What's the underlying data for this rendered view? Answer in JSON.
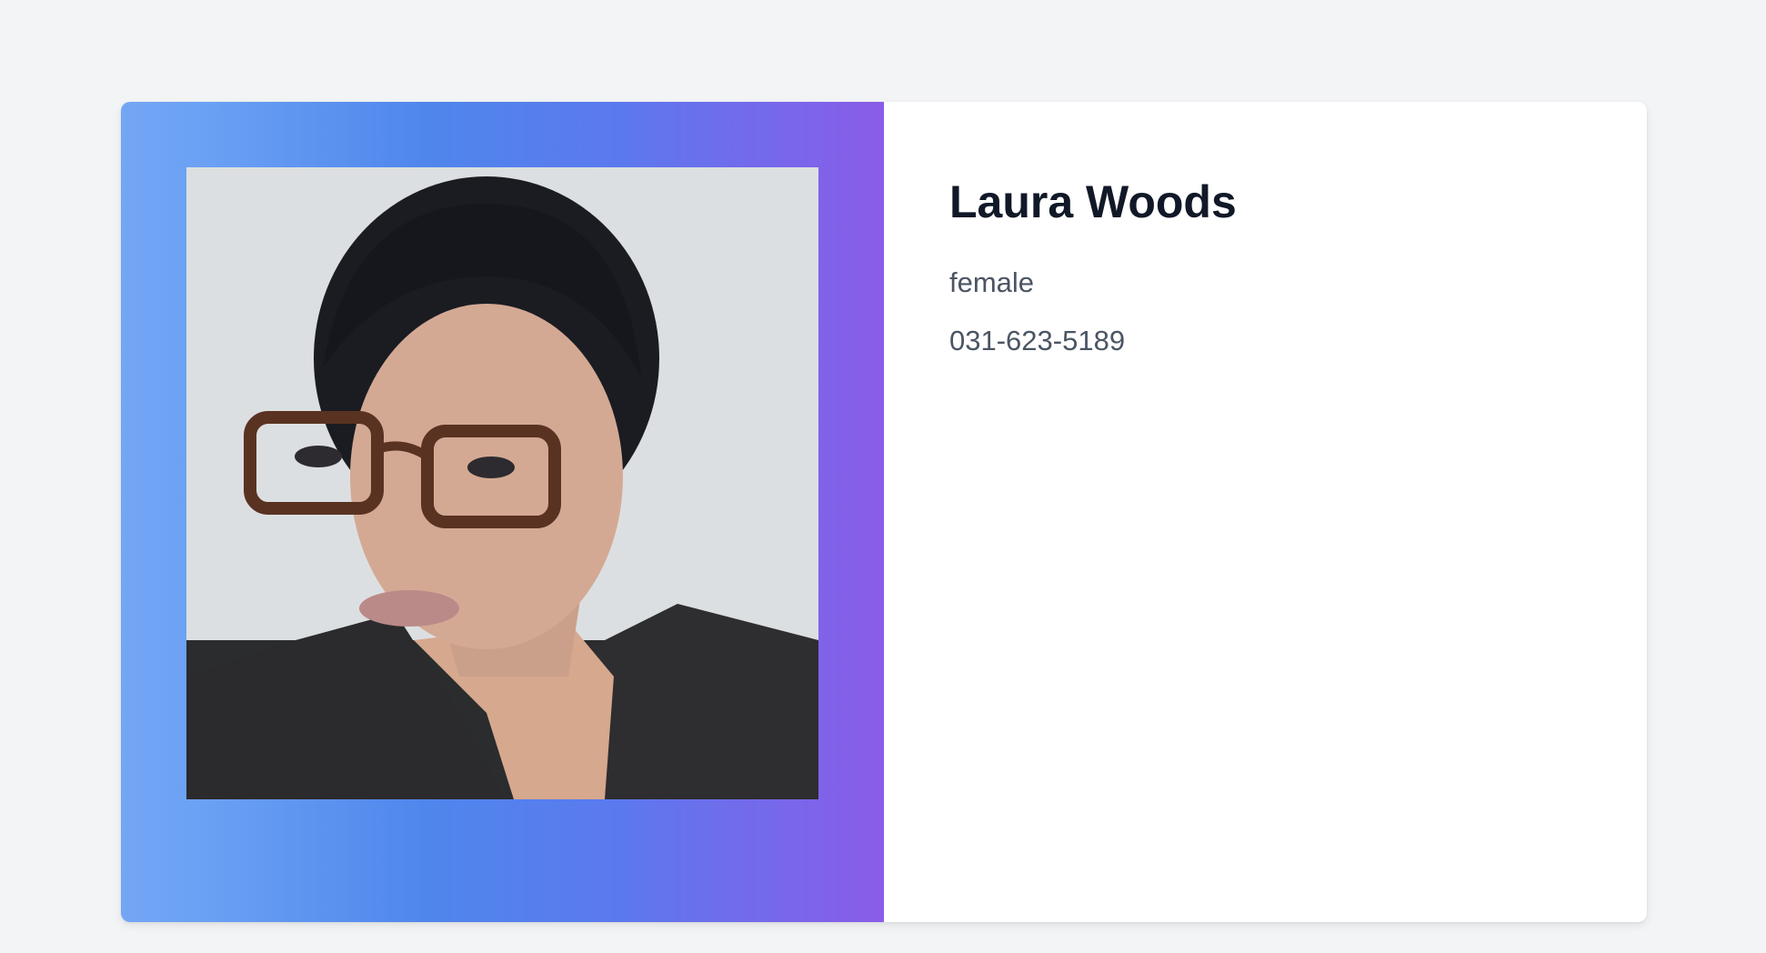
{
  "profile": {
    "name": "Laura Woods",
    "gender": "female",
    "phone": "031-623-5189",
    "photo_icon": "avatar-photo"
  },
  "colors": {
    "background": "#f3f4f6",
    "gradient_start": "#73a6f4",
    "gradient_mid": "#4f86ec",
    "gradient_end": "#8a5ce8",
    "name_text": "#111827",
    "detail_text": "#4b5563"
  }
}
